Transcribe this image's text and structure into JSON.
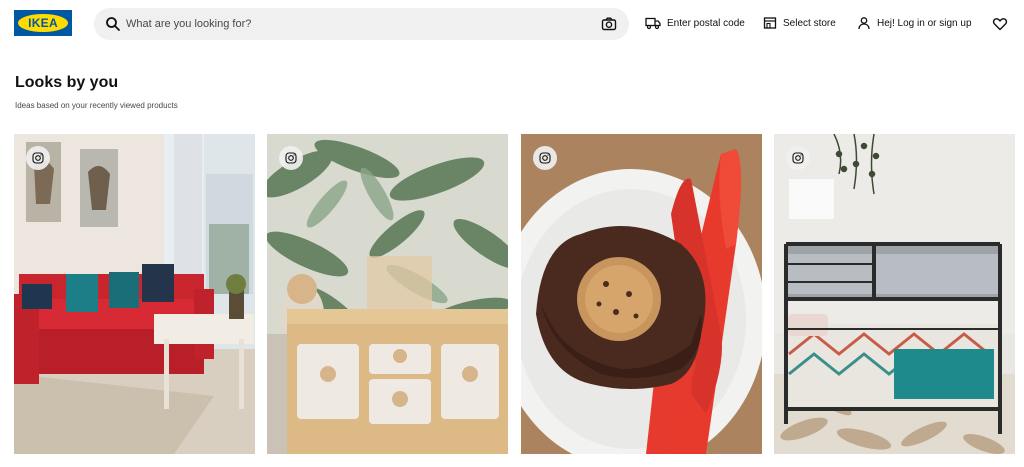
{
  "header": {
    "logo_text": "IKEA",
    "search": {
      "placeholder": "What are you looking for?"
    },
    "postal_label": "Enter postal code",
    "store_label": "Select store",
    "login_label": "Hej! Log in or sign up"
  },
  "section": {
    "title": "Looks by you",
    "subtitle": "Ideas based on your recently viewed products"
  },
  "cards": [
    {
      "icon": "instagram-icon",
      "scene": "living room with red sofa"
    },
    {
      "icon": "instagram-icon",
      "scene": "wooden storage unit with bins in front of tropical wallpaper"
    },
    {
      "icon": "instagram-icon",
      "scene": "muffin on white plate with red cutlery"
    },
    {
      "icon": "instagram-icon",
      "scene": "bunk bed in bedroom"
    }
  ],
  "colors": {
    "brand_blue": "#0058a3",
    "brand_yellow": "#ffdb00",
    "search_bg": "#f0f0f0"
  }
}
